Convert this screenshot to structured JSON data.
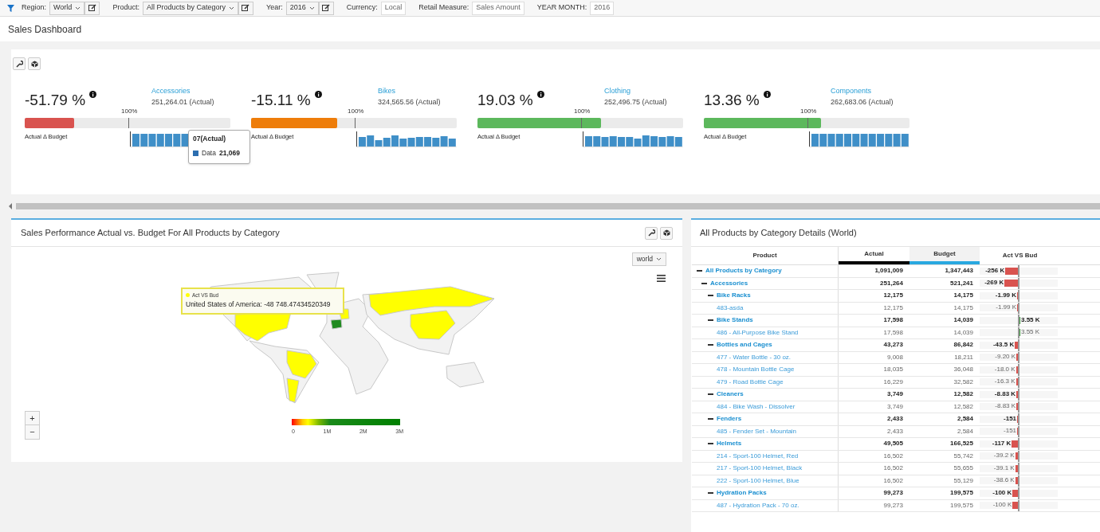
{
  "filters": [
    {
      "label": "Region:",
      "kind": "dropdown",
      "value": "World"
    },
    {
      "label": "Product:",
      "kind": "dropdown",
      "value": "All Products by Category"
    },
    {
      "label": "Year:",
      "kind": "dropdown",
      "value": "2016"
    },
    {
      "label": "Currency:",
      "kind": "readonly",
      "value": "Local"
    },
    {
      "label": "Retail Measure:",
      "kind": "readonly",
      "value": "Sales Amount"
    },
    {
      "label": "YEAR MONTH:",
      "kind": "readonly",
      "value": "2016"
    }
  ],
  "page_title": "Sales Dashboard",
  "kpis": [
    {
      "percent": "-51.79 %",
      "category": "Accessories",
      "actual": "251,264.01 (Actual)",
      "target_label": "100%",
      "level": 0.24,
      "color": "#d9534f",
      "caption": "Actual Δ Budget"
    },
    {
      "percent": "-15.11 %",
      "category": "Bikes",
      "actual": "324,565.56 (Actual)",
      "target_label": "100%",
      "level": 0.42,
      "color": "#ee7d0a",
      "caption": "Actual Δ Budget"
    },
    {
      "percent": "19.03 %",
      "category": "Clothing",
      "actual": "252,496.75 (Actual)",
      "target_label": "100%",
      "level": 0.6,
      "color": "#5cb85c",
      "caption": "Actual Δ Budget"
    },
    {
      "percent": "13.36 %",
      "category": "Components",
      "actual": "262,683.06 (Actual)",
      "target_label": "100%",
      "level": 0.57,
      "color": "#5cb85c",
      "caption": "Actual Δ Budget"
    }
  ],
  "kpi_tooltip": {
    "title": "07(Actual)",
    "series": "Data",
    "value": "21,069"
  },
  "map_panel": {
    "title": "Sales Performance Actual vs. Budget For All Products by Category",
    "region_select": "world",
    "tooltip": {
      "series": "Act VS Bud",
      "text": "United States of America: -48 748.47434520349"
    },
    "legend_ticks": [
      "0",
      "1M",
      "2M",
      "3M"
    ],
    "zoom_in": "+",
    "zoom_out": "−"
  },
  "table_panel": {
    "title": "All Products by Category Details (World)",
    "columns": [
      {
        "label": "Product"
      },
      {
        "label": "Actual",
        "color": "#000000"
      },
      {
        "label": "Budget",
        "color": "#29a8e0"
      },
      {
        "label": "Act VS Bud"
      }
    ],
    "rows": [
      {
        "product": "All Products by Category",
        "actual": "1,091,009",
        "budget": "1,347,443",
        "delta": "-256 K",
        "level": 0.33,
        "positive": false,
        "expanded": true,
        "children": [
          {
            "product": "Accessories",
            "actual": "251,264",
            "budget": "521,241",
            "delta": "-269 K",
            "level": 0.35,
            "positive": false,
            "expanded": true,
            "children": [
              {
                "product": "Bike Racks",
                "actual": "12,175",
                "budget": "14,175",
                "delta": "-1.99 K",
                "level": 0.02,
                "positive": false,
                "expanded": true,
                "children": [
                  {
                    "product": "483-asda",
                    "actual": "12,175",
                    "budget": "14,175",
                    "delta": "-1.99 K",
                    "level": 0.02,
                    "positive": false
                  }
                ]
              },
              {
                "product": "Bike Stands",
                "actual": "17,598",
                "budget": "14,039",
                "delta": "3.55 K",
                "level": 0.02,
                "positive": true,
                "expanded": true,
                "children": [
                  {
                    "product": "486 - All-Purpose Bike Stand",
                    "actual": "17,598",
                    "budget": "14,039",
                    "delta": "3.55 K",
                    "level": 0.02,
                    "positive": true
                  }
                ]
              },
              {
                "product": "Bottles and Cages",
                "actual": "43,273",
                "budget": "86,842",
                "delta": "-43.5 K",
                "level": 0.08,
                "positive": false,
                "expanded": true,
                "children": [
                  {
                    "product": "477 - Water Bottle - 30 oz.",
                    "actual": "9,008",
                    "budget": "18,211",
                    "delta": "-9.20 K",
                    "level": 0.04,
                    "positive": false
                  },
                  {
                    "product": "478 - Mountain Bottle Cage",
                    "actual": "18,035",
                    "budget": "36,048",
                    "delta": "-18.0 K",
                    "level": 0.05,
                    "positive": false
                  },
                  {
                    "product": "479 - Road Bottle Cage",
                    "actual": "16,229",
                    "budget": "32,582",
                    "delta": "-16.3 K",
                    "level": 0.05,
                    "positive": false
                  }
                ]
              },
              {
                "product": "Cleaners",
                "actual": "3,749",
                "budget": "12,582",
                "delta": "-8.83 K",
                "level": 0.04,
                "positive": false,
                "expanded": true,
                "children": [
                  {
                    "product": "484 - Bike Wash - Dissolver",
                    "actual": "3,749",
                    "budget": "12,582",
                    "delta": "-8.83 K",
                    "level": 0.04,
                    "positive": false
                  }
                ]
              },
              {
                "product": "Fenders",
                "actual": "2,433",
                "budget": "2,584",
                "delta": "-151",
                "level": 0.02,
                "positive": false,
                "expanded": true,
                "children": [
                  {
                    "product": "485 - Fender Set - Mountain",
                    "actual": "2,433",
                    "budget": "2,584",
                    "delta": "-151",
                    "level": 0.02,
                    "positive": false
                  }
                ]
              },
              {
                "product": "Helmets",
                "actual": "49,505",
                "budget": "166,525",
                "delta": "-117 K",
                "level": 0.16,
                "positive": false,
                "expanded": true,
                "children": [
                  {
                    "product": "214 - Sport-100 Helmet, Red",
                    "actual": "16,502",
                    "budget": "55,742",
                    "delta": "-39.2 K",
                    "level": 0.07,
                    "positive": false
                  },
                  {
                    "product": "217 - Sport-100 Helmet, Black",
                    "actual": "16,502",
                    "budget": "55,655",
                    "delta": "-39.1 K",
                    "level": 0.07,
                    "positive": false
                  },
                  {
                    "product": "222 - Sport-100 Helmet, Blue",
                    "actual": "16,502",
                    "budget": "55,129",
                    "delta": "-38.6 K",
                    "level": 0.07,
                    "positive": false
                  }
                ]
              },
              {
                "product": "Hydration Packs",
                "actual": "99,273",
                "budget": "199,575",
                "delta": "-100 K",
                "level": 0.14,
                "positive": false,
                "expanded": true,
                "children": [
                  {
                    "product": "487 - Hydration Pack - 70 oz.",
                    "actual": "99,273",
                    "budget": "199,575",
                    "delta": "-100 K",
                    "level": 0.14,
                    "positive": false
                  }
                ]
              }
            ]
          }
        ]
      }
    ]
  }
}
